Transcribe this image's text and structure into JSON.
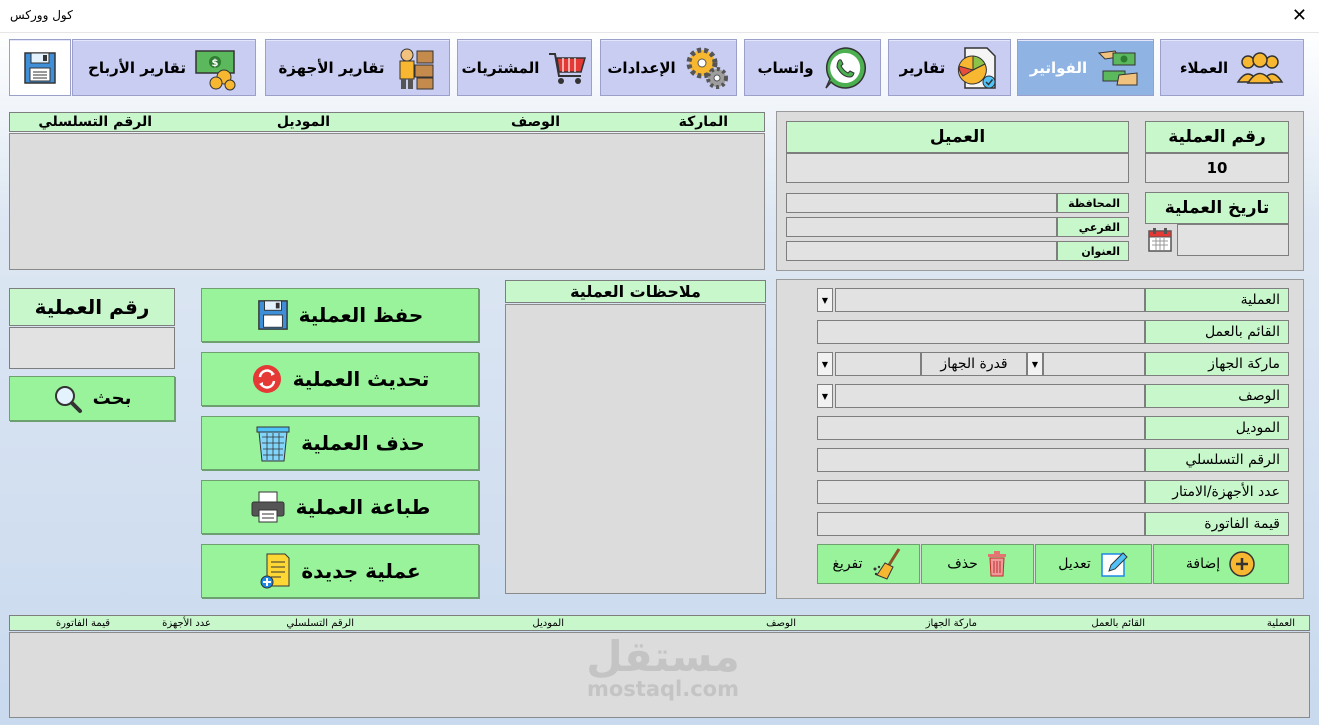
{
  "window": {
    "title": "كول ووركس",
    "close": "✕"
  },
  "nav": {
    "customers": "العملاء",
    "invoices": "الفواتير",
    "reports": "تقارير",
    "whatsapp": "واتساب",
    "settings": "الإعدادات",
    "purchases": "المشتريات",
    "device_reports": "تقارير الأجهزة",
    "profit_reports": "تقارير الأرباح"
  },
  "customer_panel": {
    "op_number_label": "رقم العملية",
    "op_number_value": "10",
    "customer_label": "العميل",
    "customer_value": "",
    "date_label": "تاريخ العملية",
    "governorate_label": "المحافظة",
    "branch_label": "الفرعي",
    "address_label": "العنوان"
  },
  "top_table": {
    "columns": [
      "الماركة",
      "الوصف",
      "الموديل",
      "الرقم التسلسلي"
    ]
  },
  "form": {
    "operation_label": "العملية",
    "worker_label": "القائم بالعمل",
    "brand_label": "ماركة الجهاز",
    "capacity_label": "قدرة الجهاز",
    "description_label": "الوصف",
    "model_label": "الموديل",
    "serial_label": "الرقم التسلسلي",
    "count_label": "عدد الأجهزة/الامتار",
    "invoice_value_label": "قيمة الفاتورة",
    "add_button": "إضافة",
    "edit_button": "تعديل",
    "delete_button": "حذف",
    "clear_button": "تفريغ"
  },
  "notes": {
    "label": "ملاحظات العملية"
  },
  "actions": {
    "save": "حفظ العملية",
    "update": "تحديث العملية",
    "delete": "حذف العملية",
    "print": "طباعة العملية",
    "new": "عملية جديدة"
  },
  "search": {
    "label": "رقم العملية",
    "value": "",
    "button": "بحث"
  },
  "bottom_table": {
    "columns": [
      "العملية",
      "القائم بالعمل",
      "ماركة الجهاز",
      "الوصف",
      "الموديل",
      "الرقم التسلسلي",
      "عدد الأجهزة",
      "قيمة الفاتورة"
    ]
  },
  "watermark": {
    "arabic": "مستقل",
    "latin": "mostaql.com"
  }
}
